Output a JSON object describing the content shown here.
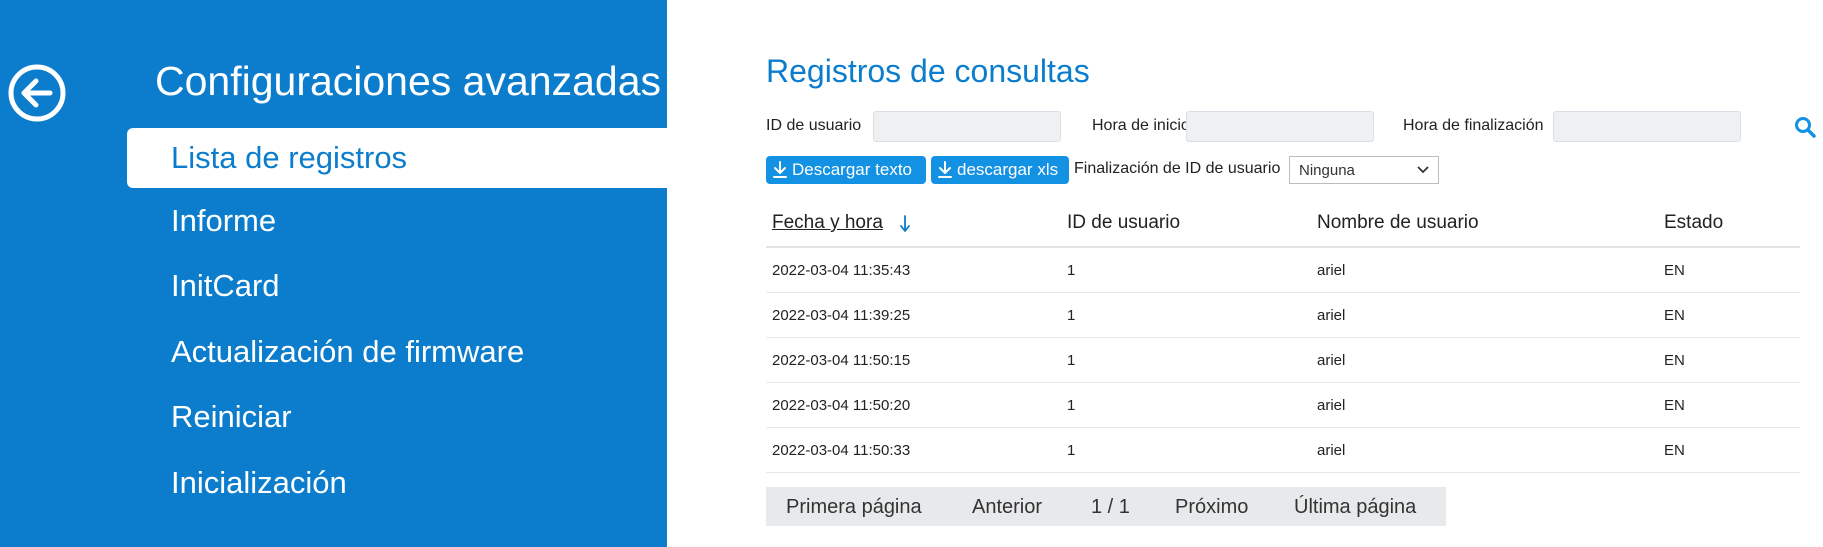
{
  "sidebar": {
    "title": "Configuraciones avanzadas",
    "items": [
      {
        "label": "Lista de registros",
        "active": true
      },
      {
        "label": "Informe"
      },
      {
        "label": "InitCard"
      },
      {
        "label": "Actualización de firmware"
      },
      {
        "label": "Reiniciar"
      },
      {
        "label": "Inicialización"
      }
    ]
  },
  "main": {
    "title": "Registros de consultas",
    "filters": {
      "user_id_label": "ID de usuario",
      "user_id_value": "",
      "start_label": "Hora de inicio",
      "start_value": "",
      "end_label": "Hora de finalización",
      "end_value": ""
    },
    "actions": {
      "download_text": "Descargar texto",
      "download_xls": "descargar xls",
      "suffix_label": "Finalización de ID de usuario",
      "suffix_selected": "Ninguna"
    },
    "table": {
      "headers": [
        "Fecha y hora",
        "ID de usuario",
        "Nombre de usuario",
        "Estado"
      ],
      "rows": [
        [
          "2022-03-04 11:35:43",
          "1",
          "ariel",
          "EN"
        ],
        [
          "2022-03-04 11:39:25",
          "1",
          "ariel",
          "EN"
        ],
        [
          "2022-03-04 11:50:15",
          "1",
          "ariel",
          "EN"
        ],
        [
          "2022-03-04 11:50:20",
          "1",
          "ariel",
          "EN"
        ],
        [
          "2022-03-04 11:50:33",
          "1",
          "ariel",
          "EN"
        ]
      ]
    },
    "pager": {
      "first": "Primera página",
      "prev": "Anterior",
      "current": "1 / 1",
      "next": "Próximo",
      "last": "Última página"
    }
  },
  "colors": {
    "primary": "#0b7dcc",
    "button": "#1391e3"
  }
}
